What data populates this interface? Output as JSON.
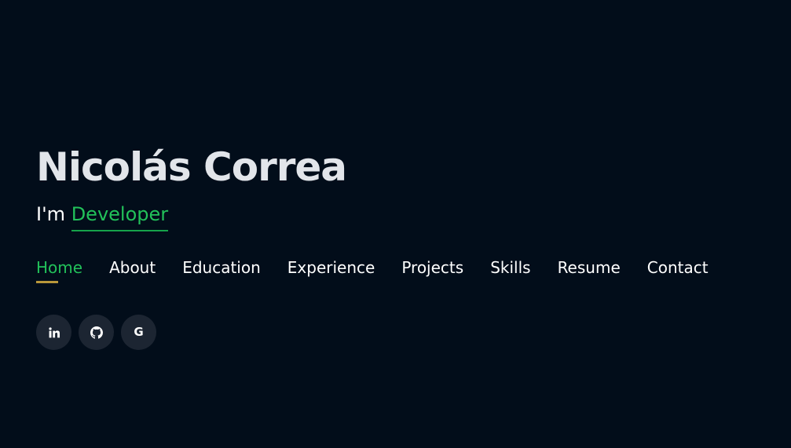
{
  "hero": {
    "name": "Nicolás Correa",
    "tagline_prefix": "I'm",
    "tagline_role": "Developer"
  },
  "nav": {
    "items": [
      {
        "label": "Home",
        "active": true
      },
      {
        "label": "About"
      },
      {
        "label": "Education"
      },
      {
        "label": "Experience"
      },
      {
        "label": "Projects"
      },
      {
        "label": "Skills"
      },
      {
        "label": "Resume"
      },
      {
        "label": "Contact"
      }
    ]
  },
  "socials": {
    "google_letter": "G"
  },
  "icons": [
    "linkedin-icon",
    "github-icon",
    "google-icon"
  ],
  "colors": {
    "background": "#020d1a",
    "accent": "#22c15a",
    "active_underline": "#b9973a",
    "social_bg": "#1c2532"
  }
}
